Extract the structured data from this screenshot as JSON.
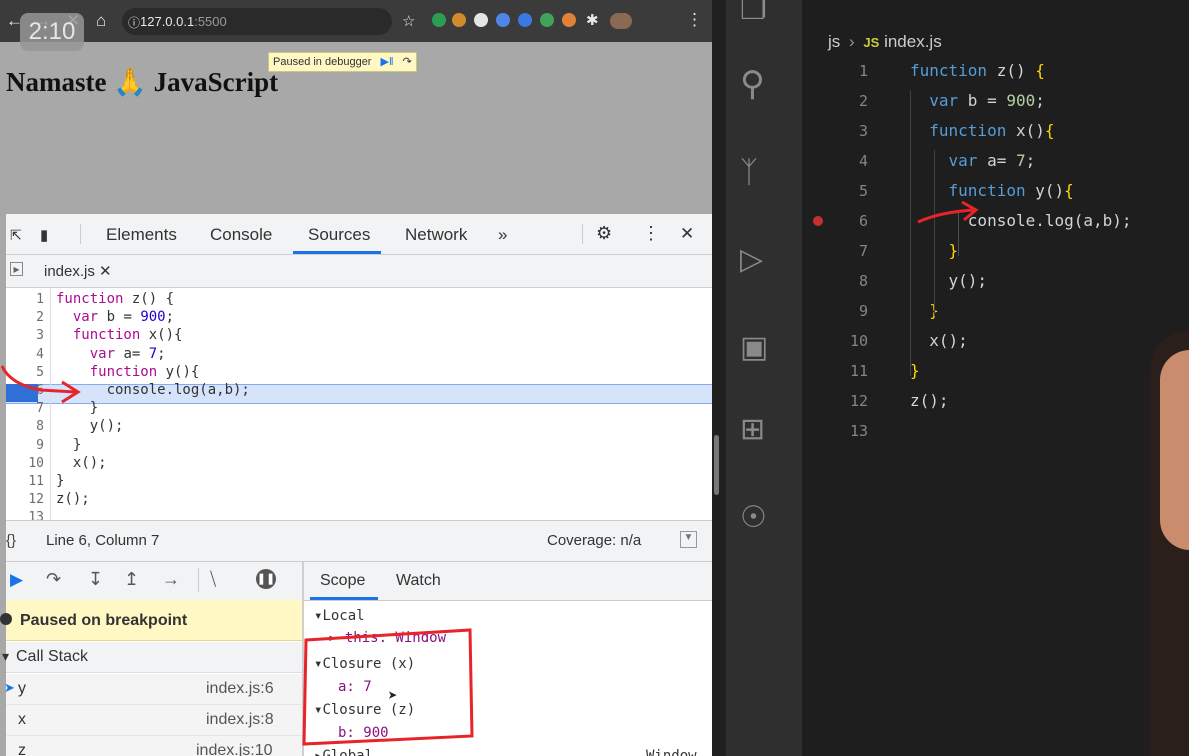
{
  "browser": {
    "url_host": "127.0.0.1",
    "url_port": ":5500",
    "page_heading": "Namaste 🙏 JavaScript",
    "paused_banner": "Paused in debugger",
    "overlay_timestamp": "2:10"
  },
  "devtools": {
    "tabs": [
      "Elements",
      "Console",
      "Sources",
      "Network",
      "»"
    ],
    "active_tab": "Sources",
    "file_tab": "index.js",
    "code_lines": [
      {
        "n": "1",
        "text": "function z() {"
      },
      {
        "n": "2",
        "text": "  var b = 900;"
      },
      {
        "n": "3",
        "text": "  function x(){"
      },
      {
        "n": "4",
        "text": "    var a= 7;"
      },
      {
        "n": "5",
        "text": "    function y(){"
      },
      {
        "n": "6",
        "text": "      console.log(a,b);"
      },
      {
        "n": "7",
        "text": "    }"
      },
      {
        "n": "8",
        "text": "    y();"
      },
      {
        "n": "9",
        "text": "  }"
      },
      {
        "n": "10",
        "text": "  x();"
      },
      {
        "n": "11",
        "text": "}"
      },
      {
        "n": "12",
        "text": "z();"
      },
      {
        "n": "13",
        "text": ""
      }
    ],
    "status_position": "Line 6, Column 7",
    "coverage": "Coverage: n/a",
    "paused_message": "Paused on breakpoint",
    "call_stack_label": "Call Stack",
    "call_stack": [
      {
        "fn": "y",
        "loc": "index.js:6"
      },
      {
        "fn": "x",
        "loc": "index.js:8"
      },
      {
        "fn": "z",
        "loc": "index.js:10"
      }
    ],
    "side_tabs": [
      "Scope",
      "Watch"
    ],
    "scope": {
      "local": "Local",
      "this_label": "this: Window",
      "closure_x": "Closure (x)",
      "a_value": "a: 7",
      "closure_z": "Closure (z)",
      "b_value": "b: 900",
      "global": "Global",
      "global_value": "Window"
    }
  },
  "vscode": {
    "breadcrumb_folder": "js",
    "breadcrumb_file": "index.js",
    "lines": [
      {
        "n": "1",
        "text": "function z() {"
      },
      {
        "n": "2",
        "text": "  var b = 900;"
      },
      {
        "n": "3",
        "text": "  function x(){"
      },
      {
        "n": "4",
        "text": "    var a= 7;"
      },
      {
        "n": "5",
        "text": "    function y(){"
      },
      {
        "n": "6",
        "text": "      console.log(a,b);"
      },
      {
        "n": "7",
        "text": "    }"
      },
      {
        "n": "8",
        "text": "    y();"
      },
      {
        "n": "9",
        "text": "  }"
      },
      {
        "n": "10",
        "text": "  x();"
      },
      {
        "n": "11",
        "text": "}"
      },
      {
        "n": "12",
        "text": "z();"
      },
      {
        "n": "13",
        "text": ""
      }
    ]
  },
  "colors": {
    "annotation_red": "#e8242a",
    "devtools_accent": "#1a73e8",
    "breakpoint_red": "#c62f2f"
  }
}
